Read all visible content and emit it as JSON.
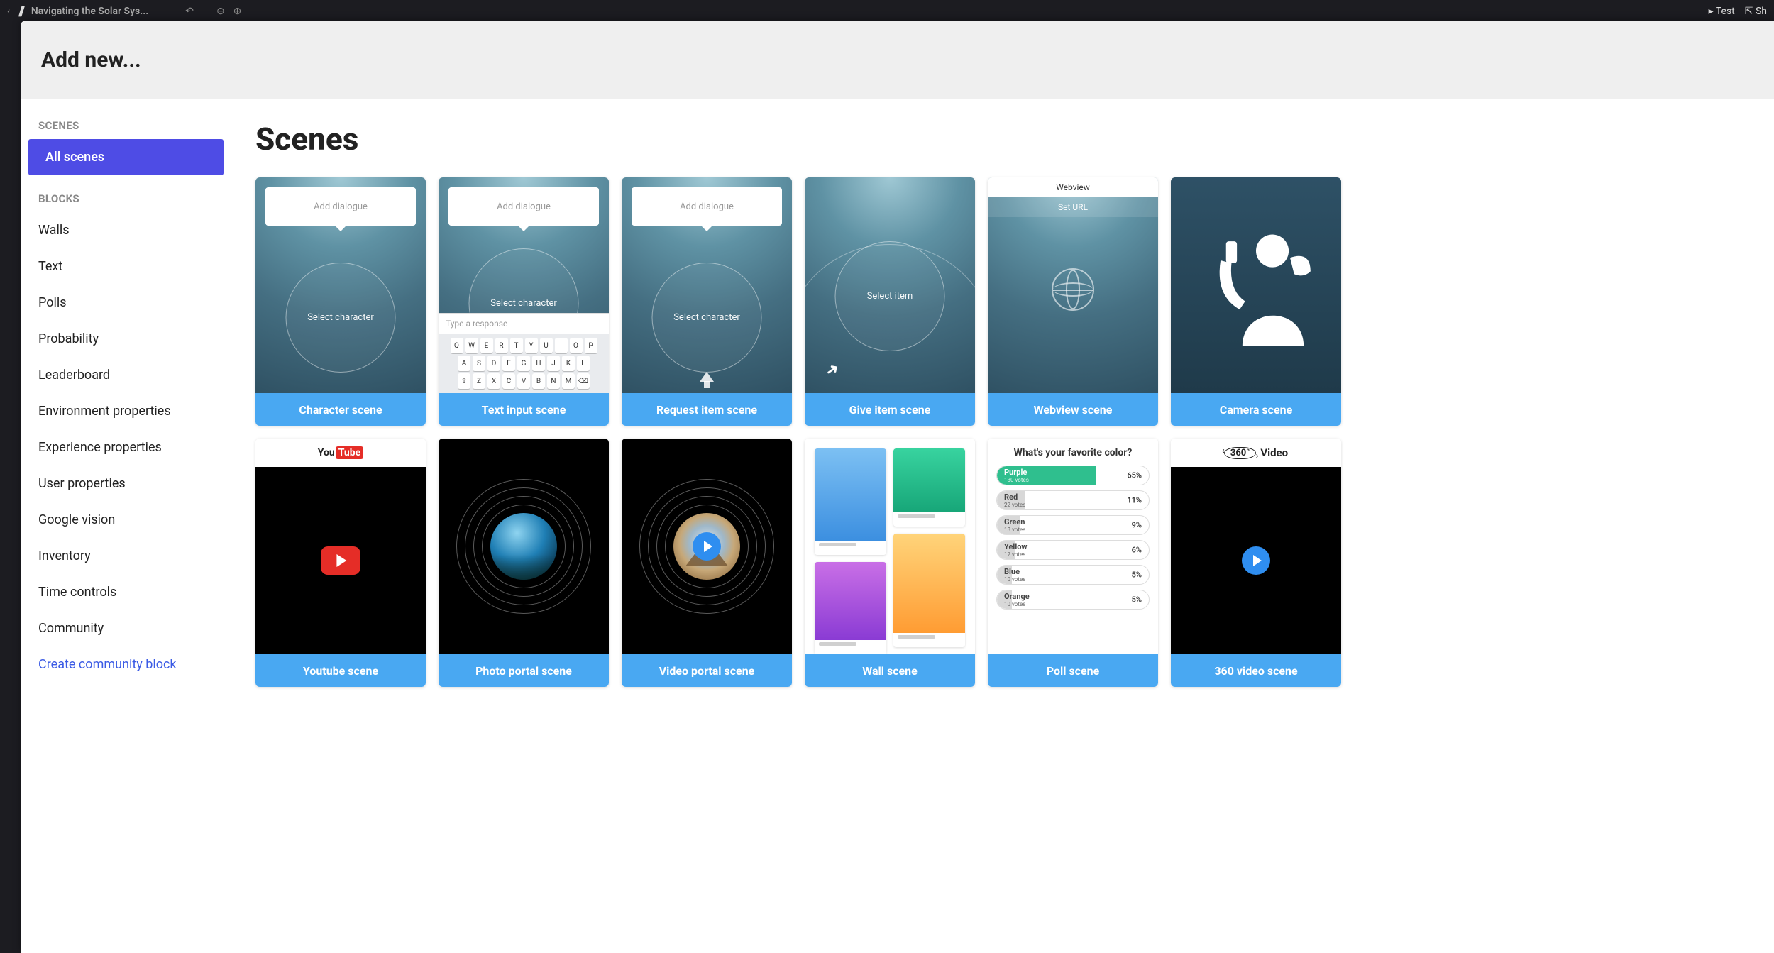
{
  "app": {
    "tab_title": "Navigating the Solar Sys...",
    "test_label": "Test",
    "share_label": "Sh"
  },
  "modal": {
    "title": "Add new..."
  },
  "sidebar": {
    "group_scenes": "SCENES",
    "group_blocks": "BLOCKS",
    "all_scenes": "All scenes",
    "blocks": [
      "Walls",
      "Text",
      "Polls",
      "Probability",
      "Leaderboard",
      "Environment properties",
      "Experience properties",
      "User properties",
      "Google vision",
      "Inventory",
      "Time controls",
      "Community"
    ],
    "create_link": "Create community block"
  },
  "main": {
    "heading": "Scenes",
    "placeholders": {
      "add_dialogue": "Add dialogue",
      "select_character": "Select character",
      "select_item": "Select item",
      "type_response": "Type a response",
      "webview": "Webview",
      "set_url": "Set URL",
      "v360_label": "Video"
    },
    "keyboard": {
      "row1": [
        "Q",
        "W",
        "E",
        "R",
        "T",
        "Y",
        "U",
        "I",
        "O",
        "P"
      ],
      "row2": [
        "A",
        "S",
        "D",
        "F",
        "G",
        "H",
        "J",
        "K",
        "L"
      ],
      "row3": [
        "⇧",
        "Z",
        "X",
        "C",
        "V",
        "B",
        "N",
        "M",
        "⌫"
      ]
    },
    "cards": [
      {
        "title": "Character scene"
      },
      {
        "title": "Text input scene"
      },
      {
        "title": "Request item scene"
      },
      {
        "title": "Give item scene"
      },
      {
        "title": "Webview scene"
      },
      {
        "title": "Camera scene"
      },
      {
        "title": "Youtube scene"
      },
      {
        "title": "Photo portal scene"
      },
      {
        "title": "Video portal scene"
      },
      {
        "title": "Wall scene"
      },
      {
        "title": "Poll scene"
      },
      {
        "title": "360 video scene"
      }
    ],
    "poll": {
      "question": "What's your favorite color?",
      "options": [
        {
          "name": "Purple",
          "votes": "130 votes",
          "pct": "65%",
          "width": 65
        },
        {
          "name": "Red",
          "votes": "22 votes",
          "pct": "11%",
          "width": 18
        },
        {
          "name": "Green",
          "votes": "18 votes",
          "pct": "9%",
          "width": 15
        },
        {
          "name": "Yellow",
          "votes": "12 votes",
          "pct": "6%",
          "width": 12
        },
        {
          "name": "Blue",
          "votes": "10 votes",
          "pct": "5%",
          "width": 10
        },
        {
          "name": "Orange",
          "votes": "10 votes",
          "pct": "5%",
          "width": 10
        }
      ]
    },
    "youtube_word": {
      "you": "You",
      "tube": "Tube"
    }
  }
}
